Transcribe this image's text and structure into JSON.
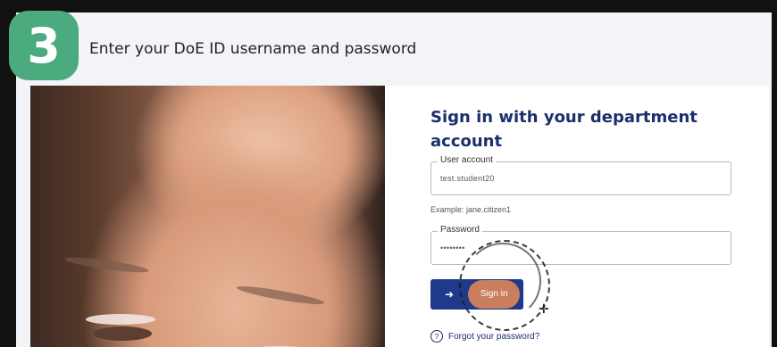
{
  "step": {
    "number": "3"
  },
  "heading": "Enter your DoE ID username and password",
  "signin": {
    "title": "Sign in with your department account",
    "user_account_label": "User account",
    "user_account_value": "test.student20",
    "hint": "Example: jane.citizen1",
    "password_label": "Password",
    "password_value": "••••••••",
    "button_label": "Sign in",
    "button_icon": "sign-in-arrow-icon",
    "forgot_label": "Forgot your password?",
    "forgot_icon": "question-circle-icon"
  },
  "colors": {
    "badge": "#4caa7f",
    "title": "#1b2f6b",
    "button": "#1f3a8a",
    "highlight": "#e78b55"
  }
}
